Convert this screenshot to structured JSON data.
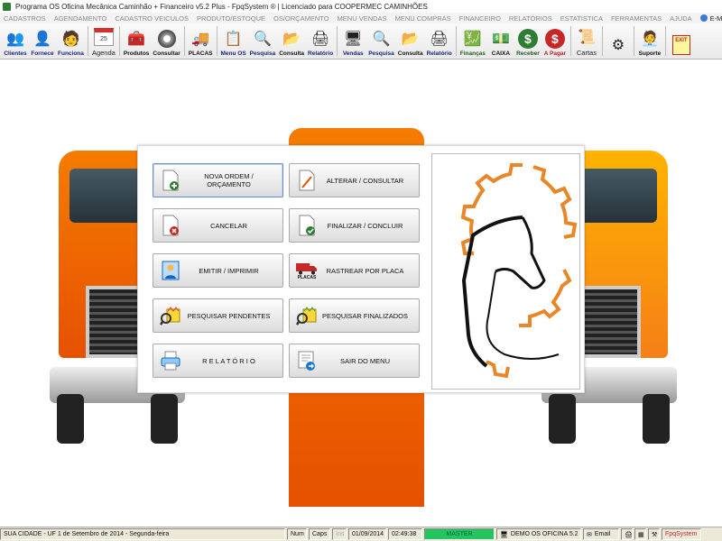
{
  "window": {
    "title": "Programa OS Oficina Mecânica Caminhão + Financeiro v5.2 Plus - FpqSystem ® | Licenciado para  COOPERMEC CAMINHÕES"
  },
  "menu": {
    "items": [
      "CADASTROS",
      "AGENDAMENTO",
      "CADASTRO VEICULOS",
      "PRODUTO/ESTOQUE",
      "OS/ORÇAMENTO",
      "MENU VENDAS",
      "MENU COMPRAS",
      "FINANCEIRO",
      "RELATÓRIOS",
      "ESTATISTICA",
      "FERRAMENTAS",
      "AJUDA"
    ],
    "email": "E-MAIL"
  },
  "toolbar": {
    "clientes": "Clientes",
    "fornece": "Fornece",
    "funciona": "Funciona",
    "agenda": "Agenda",
    "agenda_day": "25",
    "produtos": "Produtos",
    "consultar": "Consultar",
    "placas": "PLACAS",
    "menu_os": "Menu OS",
    "pesquisa1": "Pesquisa",
    "consulta1": "Consulta",
    "relatorio1": "Relatório",
    "vendas": "Vendas",
    "pesquisa2": "Pesquisa",
    "consulta2": "Consulta",
    "relatorio2": "Relatório",
    "financas": "Finanças",
    "caixa": "CAIXA",
    "receber": "Receber",
    "apagar": "A Pagar",
    "cartas": "Cartas",
    "suporte": "Suporte",
    "exit_tag": "EXIT"
  },
  "dialog": {
    "buttons": {
      "nova": "NOVA ORDEM / ORÇAMENTO",
      "alterar": "ALTERAR  /  CONSULTAR",
      "cancelar": "CANCELAR",
      "finalizar": "FINALIZAR  /  CONCLUIR",
      "emitir": "EMITIR  /  IMPRIMIR",
      "rastrear": "RASTREAR POR PLACA",
      "rastrear_tag": "PLACAS",
      "pendentes": "PESQUISAR PENDENTES",
      "finalizados": "PESQUISAR FINALIZADOS",
      "relatorio": "R E L A T Ó R I O",
      "sair": "SAIR DO MENU"
    }
  },
  "status": {
    "city": "SUA CIDADE - UF  1 de Setembro de 2014 - Segunda-feira",
    "num": "Num",
    "caps": "Caps",
    "ins": "Ins",
    "date": "01/09/2014",
    "time": "02:49:38",
    "mode": "MASTER",
    "demo": "DEMO OS OFICINA 5.2",
    "email": "Email",
    "brand": "FpqSystem"
  },
  "colors": {
    "accent_orange": "#e8862a",
    "master_green": "#22c55e",
    "brand_red": "#c62828"
  }
}
